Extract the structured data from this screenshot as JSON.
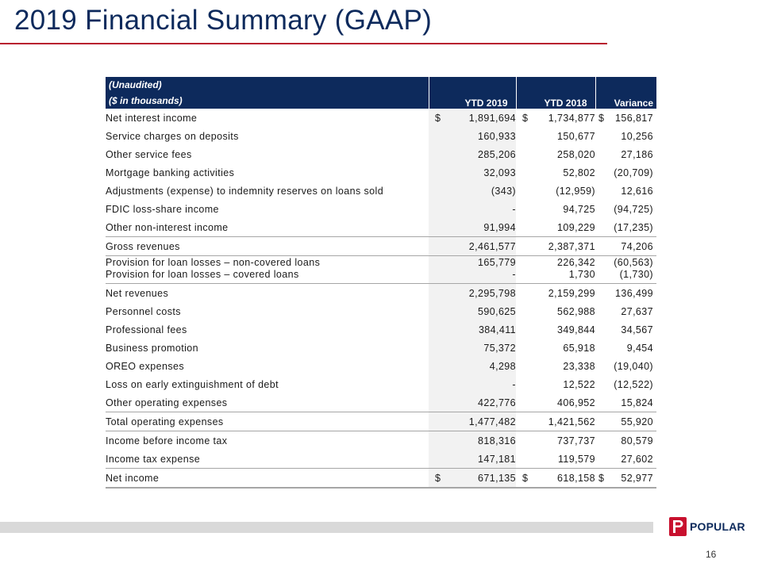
{
  "title": "2019 Financial Summary (GAAP)",
  "table": {
    "header": {
      "note": "(Unaudited)",
      "units": "($ in thousands)",
      "col1": "YTD 2019",
      "col2": "YTD 2018",
      "col3": "Variance"
    },
    "rows": [
      {
        "label": "Net interest income",
        "v1": "1,891,694",
        "v2": "1,734,877",
        "v3": "156,817",
        "cur1": "$",
        "cur2": "$",
        "cur3": "$"
      },
      {
        "label": "Service charges on deposits",
        "v1": "160,933",
        "v2": "150,677",
        "v3": "10,256"
      },
      {
        "label": "Other service fees",
        "v1": "285,206",
        "v2": "258,020",
        "v3": "27,186"
      },
      {
        "label": "Mortgage banking activities",
        "v1": "32,093",
        "v2": "52,802",
        "v3": "(20,709)"
      },
      {
        "label": "Adjustments (expense) to indemnity reserves on loans sold",
        "v1": "(343)",
        "v2": "(12,959)",
        "v3": "12,616"
      },
      {
        "label": "FDIC loss-share income",
        "v1": "-",
        "v2": "94,725",
        "v3": "(94,725)"
      },
      {
        "label": "Other non-interest income",
        "v1": "91,994",
        "v2": "109,229",
        "v3": "(17,235)"
      },
      {
        "label": "Gross revenues",
        "v1": "2,461,577",
        "v2": "2,387,371",
        "v3": "74,206"
      },
      {
        "label": "Provision for loan losses – non-covered loans",
        "v1": "165,779",
        "v2": "226,342",
        "v3": "(60,563)"
      },
      {
        "label": "Provision for loan losses – covered loans",
        "v1": "-",
        "v2": "1,730",
        "v3": "(1,730)"
      },
      {
        "label": "Net revenues",
        "v1": "2,295,798",
        "v2": "2,159,299",
        "v3": "136,499"
      },
      {
        "label": "Personnel costs",
        "v1": "590,625",
        "v2": "562,988",
        "v3": "27,637"
      },
      {
        "label": "Professional fees",
        "v1": "384,411",
        "v2": "349,844",
        "v3": "34,567"
      },
      {
        "label": "Business promotion",
        "v1": "75,372",
        "v2": "65,918",
        "v3": "9,454"
      },
      {
        "label": "OREO expenses",
        "v1": "4,298",
        "v2": "23,338",
        "v3": "(19,040)"
      },
      {
        "label": "Loss on early extinguishment of debt",
        "v1": "-",
        "v2": "12,522",
        "v3": "(12,522)"
      },
      {
        "label": "Other operating expenses",
        "v1": "422,776",
        "v2": "406,952",
        "v3": "15,824"
      },
      {
        "label": "Total operating expenses",
        "v1": "1,477,482",
        "v2": "1,421,562",
        "v3": "55,920"
      },
      {
        "label": "Income before income tax",
        "v1": "818,316",
        "v2": "737,737",
        "v3": "80,579"
      },
      {
        "label": "Income tax expense",
        "v1": "147,181",
        "v2": "119,579",
        "v3": "27,602"
      },
      {
        "label": "Net income",
        "v1": "671,135",
        "v2": "618,158",
        "v3": "52,977",
        "cur1": "$",
        "cur2": "$",
        "cur3": "$"
      }
    ]
  },
  "footer": {
    "logo_text": "POPULAR",
    "logo_mark": "P",
    "page_number": "16"
  },
  "colors": {
    "header_bg": "#0d2a5c",
    "title_color": "#0d2a5c",
    "accent_rule": "#b8182e",
    "logo_red": "#c8102e"
  }
}
